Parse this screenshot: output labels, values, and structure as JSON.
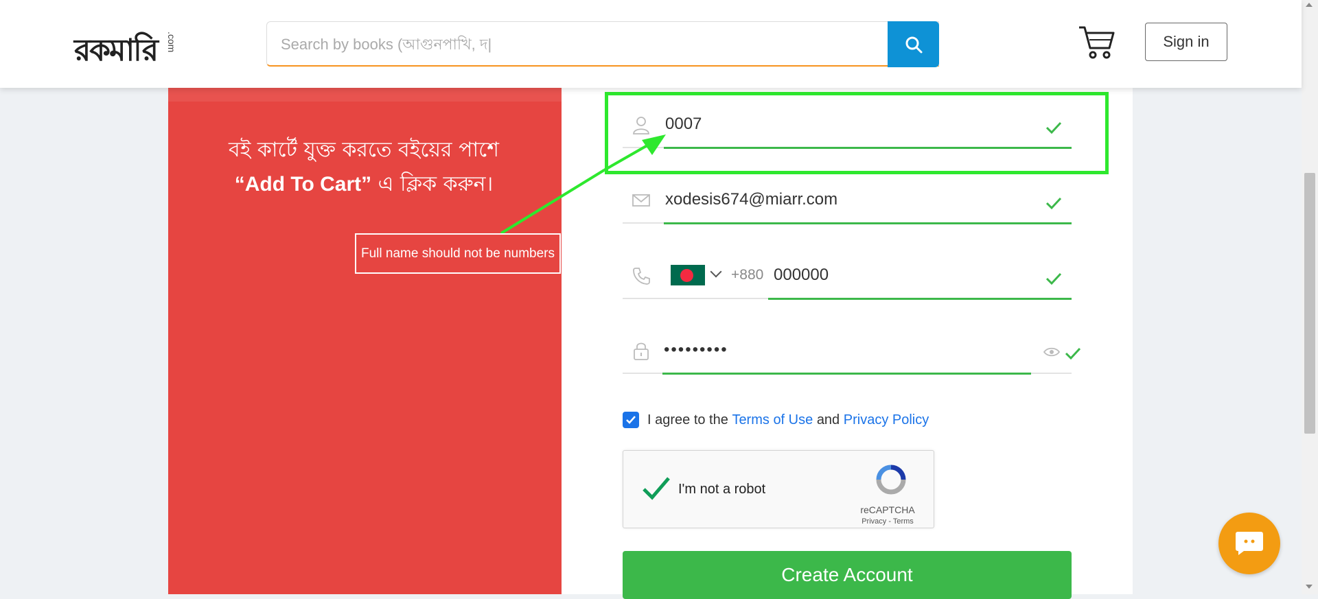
{
  "header": {
    "logo_text": "রকমারি",
    "logo_suffix": ".com",
    "search_placeholder": "Search by books (আগুনপাখি, দ|",
    "signin_label": "Sign in"
  },
  "promo": {
    "line1": "বই কার্টে যুক্ত করতে বইয়ের পাশে",
    "line2_en": "“Add To Cart”",
    "line2_bn": " এ ক্লিক করুন।"
  },
  "form": {
    "name_value": "0007",
    "email_value": "xodesis674@miarr.com",
    "phone_prefix": "+880",
    "phone_value": "000000",
    "password_value": "•••••••••",
    "agree_text": "I agree to the",
    "terms_link": "Terms of Use",
    "and_text": "and",
    "privacy_link": "Privacy Policy",
    "create_label": "Create Account"
  },
  "captcha": {
    "label": "I'm not a robot",
    "brand": "reCAPTCHA",
    "privacy_terms": "Privacy - Terms"
  },
  "annotation": {
    "note": "Full name should not be numbers"
  },
  "colors": {
    "accent_red": "#e64541",
    "success_green": "#3cb84a",
    "search_blue": "#0e92d6",
    "link_blue": "#1a73e8",
    "highlight_green": "#2ee82e",
    "chat_orange": "#f39c12"
  },
  "icons": [
    "search-icon",
    "cart-icon",
    "user-icon",
    "mail-icon",
    "phone-icon",
    "lock-icon",
    "eye-icon",
    "check-icon",
    "chat-icon",
    "recaptcha-icon"
  ]
}
